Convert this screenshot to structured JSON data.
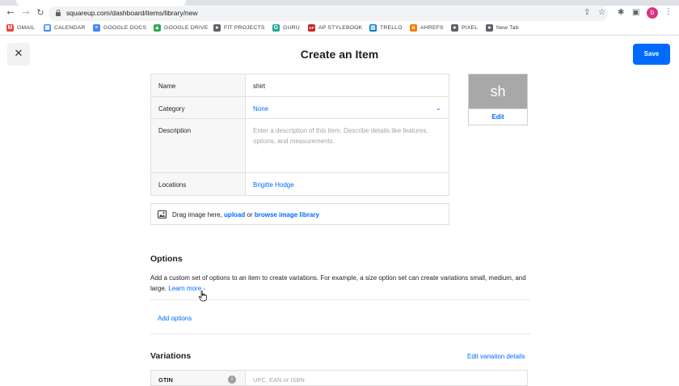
{
  "browser": {
    "url": "squareup.com/dashboard/items/library/new",
    "bookmarks": [
      {
        "label": "GMAIL",
        "icon": "gmail-icon",
        "color": "#ea4335"
      },
      {
        "label": "CALENDAR",
        "icon": "calendar-icon",
        "color": "#4285f4"
      },
      {
        "label": "GOOGLE DOCS",
        "icon": "docs-icon",
        "color": "#4285f4"
      },
      {
        "label": "GOOGLE DRIVE",
        "icon": "drive-icon",
        "color": "#34a853"
      },
      {
        "label": "FIT PROJECTS",
        "icon": "globe-icon",
        "color": "#5f6368"
      },
      {
        "label": "GURU",
        "icon": "guru-icon",
        "color": "#26a69a"
      },
      {
        "label": "AP STYLEBOOK",
        "icon": "ap-icon",
        "color": "#c62828"
      },
      {
        "label": "TRELLO",
        "icon": "trello-icon",
        "color": "#0079bf"
      },
      {
        "label": "AHREFS",
        "icon": "ahrefs-icon",
        "color": "#f57c00"
      },
      {
        "label": "PIXEL",
        "icon": "globe-icon",
        "color": "#5f6368"
      },
      {
        "label": "New Tab",
        "icon": "globe-icon",
        "color": "#5f6368"
      }
    ],
    "profile_initial": "b"
  },
  "header": {
    "title": "Create an Item",
    "save_label": "Save",
    "close_icon": "close-icon"
  },
  "form": {
    "name_label": "Name",
    "name_value": "shirt",
    "category_label": "Category",
    "category_value": "None",
    "description_label": "Description",
    "description_placeholder": "Enter a description of this item. Describe details like features, options, and measurements.",
    "locations_label": "Locations",
    "locations_value": "Brigitte Hodge"
  },
  "thumbnail": {
    "initials": "sh",
    "edit_label": "Edit"
  },
  "upload": {
    "prefix": "Drag image here,",
    "upload_link": "upload",
    "or": "or",
    "browse_link": "browse image library"
  },
  "options": {
    "title": "Options",
    "description": "Add a custom set of options to an item to create variations. For example, a size option set can create variations small, medium, and large.",
    "learn_more": "Learn more",
    "add_options": "Add options"
  },
  "variations": {
    "title": "Variations",
    "edit_details": "Edit variation details",
    "gtin_label": "GTIN",
    "gtin_placeholder": "UPC, EAN or ISBN"
  },
  "colors": {
    "accent": "#006aff",
    "thumbnail_bg": "#a8a8a8"
  }
}
